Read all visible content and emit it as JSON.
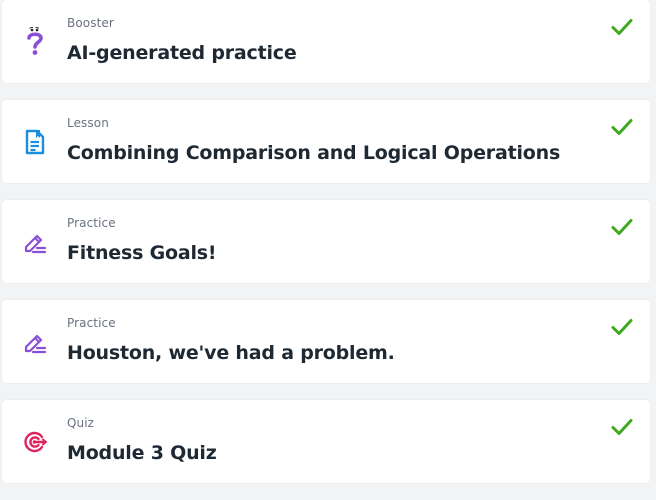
{
  "items": [
    {
      "type": "Booster",
      "title": "AI-generated practice",
      "icon": "booster-question-icon",
      "completed": true
    },
    {
      "type": "Lesson",
      "title": "Combining Comparison and Logical Operations",
      "icon": "lesson-document-icon",
      "completed": true
    },
    {
      "type": "Practice",
      "title": "Fitness Goals!",
      "icon": "practice-pencil-icon",
      "completed": true
    },
    {
      "type": "Practice",
      "title": "Houston, we've had a problem.",
      "icon": "practice-pencil-icon",
      "completed": true
    },
    {
      "type": "Quiz",
      "title": "Module 3 Quiz",
      "icon": "quiz-target-icon",
      "completed": true
    }
  ],
  "colors": {
    "check": "#3fa81f",
    "booster": "#8a4fd8",
    "lesson": "#1a8fe0",
    "practice": "#8a4fd8",
    "quiz": "#e0245e"
  }
}
